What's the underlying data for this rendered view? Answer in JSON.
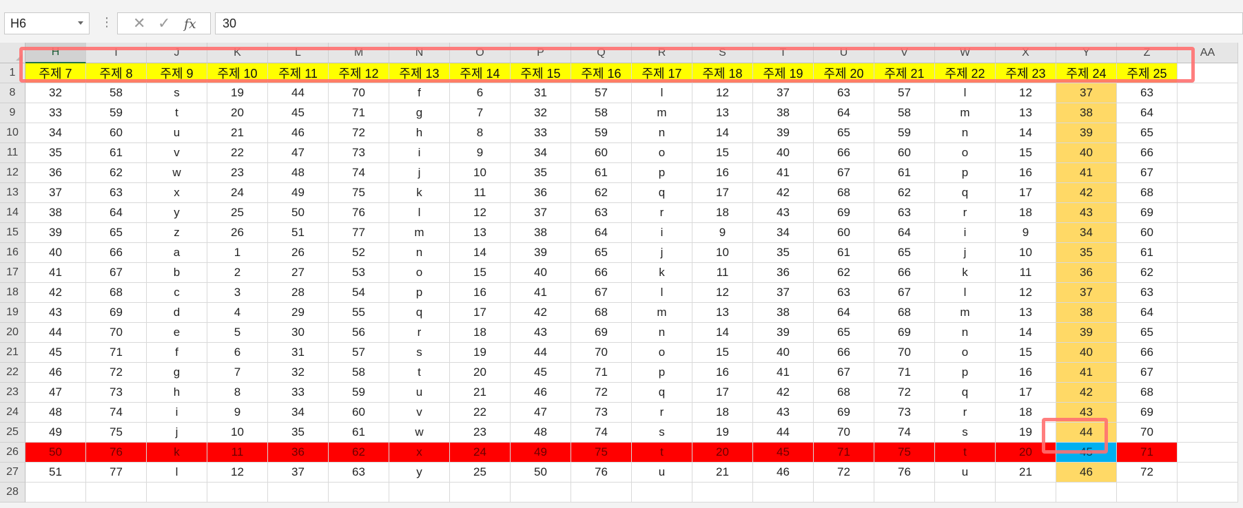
{
  "formula_bar": {
    "name_box": "H6",
    "cancel_icon": "✕",
    "enter_icon": "✓",
    "fx_label": "fx",
    "formula_value": "30"
  },
  "columns": [
    "H",
    "I",
    "J",
    "K",
    "L",
    "M",
    "N",
    "O",
    "P",
    "Q",
    "R",
    "S",
    "T",
    "U",
    "V",
    "W",
    "X",
    "Y",
    "Z",
    "AA"
  ],
  "header_row": {
    "number": "1",
    "cells": [
      "주제 7",
      "주제 8",
      "주제 9",
      "주제 10",
      "주제 11",
      "주제 12",
      "주제 13",
      "주제 14",
      "주제 15",
      "주제 16",
      "주제 17",
      "주제 18",
      "주제 19",
      "주제 20",
      "주제 21",
      "주제 22",
      "주제 23",
      "주제 24",
      "주제 25",
      ""
    ]
  },
  "rows": [
    {
      "number": "8",
      "cells": [
        "32",
        "58",
        "s",
        "19",
        "44",
        "70",
        "f",
        "6",
        "31",
        "57",
        "l",
        "12",
        "37",
        "63",
        "57",
        "l",
        "12",
        "37",
        "63",
        ""
      ]
    },
    {
      "number": "9",
      "cells": [
        "33",
        "59",
        "t",
        "20",
        "45",
        "71",
        "g",
        "7",
        "32",
        "58",
        "m",
        "13",
        "38",
        "64",
        "58",
        "m",
        "13",
        "38",
        "64",
        ""
      ]
    },
    {
      "number": "10",
      "cells": [
        "34",
        "60",
        "u",
        "21",
        "46",
        "72",
        "h",
        "8",
        "33",
        "59",
        "n",
        "14",
        "39",
        "65",
        "59",
        "n",
        "14",
        "39",
        "65",
        ""
      ]
    },
    {
      "number": "11",
      "cells": [
        "35",
        "61",
        "v",
        "22",
        "47",
        "73",
        "i",
        "9",
        "34",
        "60",
        "o",
        "15",
        "40",
        "66",
        "60",
        "o",
        "15",
        "40",
        "66",
        ""
      ]
    },
    {
      "number": "12",
      "cells": [
        "36",
        "62",
        "w",
        "23",
        "48",
        "74",
        "j",
        "10",
        "35",
        "61",
        "p",
        "16",
        "41",
        "67",
        "61",
        "p",
        "16",
        "41",
        "67",
        ""
      ]
    },
    {
      "number": "13",
      "cells": [
        "37",
        "63",
        "x",
        "24",
        "49",
        "75",
        "k",
        "11",
        "36",
        "62",
        "q",
        "17",
        "42",
        "68",
        "62",
        "q",
        "17",
        "42",
        "68",
        ""
      ]
    },
    {
      "number": "14",
      "cells": [
        "38",
        "64",
        "y",
        "25",
        "50",
        "76",
        "l",
        "12",
        "37",
        "63",
        "r",
        "18",
        "43",
        "69",
        "63",
        "r",
        "18",
        "43",
        "69",
        ""
      ]
    },
    {
      "number": "15",
      "cells": [
        "39",
        "65",
        "z",
        "26",
        "51",
        "77",
        "m",
        "13",
        "38",
        "64",
        "i",
        "9",
        "34",
        "60",
        "64",
        "i",
        "9",
        "34",
        "60",
        ""
      ]
    },
    {
      "number": "16",
      "cells": [
        "40",
        "66",
        "a",
        "1",
        "26",
        "52",
        "n",
        "14",
        "39",
        "65",
        "j",
        "10",
        "35",
        "61",
        "65",
        "j",
        "10",
        "35",
        "61",
        ""
      ]
    },
    {
      "number": "17",
      "cells": [
        "41",
        "67",
        "b",
        "2",
        "27",
        "53",
        "o",
        "15",
        "40",
        "66",
        "k",
        "11",
        "36",
        "62",
        "66",
        "k",
        "11",
        "36",
        "62",
        ""
      ]
    },
    {
      "number": "18",
      "cells": [
        "42",
        "68",
        "c",
        "3",
        "28",
        "54",
        "p",
        "16",
        "41",
        "67",
        "l",
        "12",
        "37",
        "63",
        "67",
        "l",
        "12",
        "37",
        "63",
        ""
      ]
    },
    {
      "number": "19",
      "cells": [
        "43",
        "69",
        "d",
        "4",
        "29",
        "55",
        "q",
        "17",
        "42",
        "68",
        "m",
        "13",
        "38",
        "64",
        "68",
        "m",
        "13",
        "38",
        "64",
        ""
      ]
    },
    {
      "number": "20",
      "cells": [
        "44",
        "70",
        "e",
        "5",
        "30",
        "56",
        "r",
        "18",
        "43",
        "69",
        "n",
        "14",
        "39",
        "65",
        "69",
        "n",
        "14",
        "39",
        "65",
        ""
      ]
    },
    {
      "number": "21",
      "cells": [
        "45",
        "71",
        "f",
        "6",
        "31",
        "57",
        "s",
        "19",
        "44",
        "70",
        "o",
        "15",
        "40",
        "66",
        "70",
        "o",
        "15",
        "40",
        "66",
        ""
      ]
    },
    {
      "number": "22",
      "cells": [
        "46",
        "72",
        "g",
        "7",
        "32",
        "58",
        "t",
        "20",
        "45",
        "71",
        "p",
        "16",
        "41",
        "67",
        "71",
        "p",
        "16",
        "41",
        "67",
        ""
      ]
    },
    {
      "number": "23",
      "cells": [
        "47",
        "73",
        "h",
        "8",
        "33",
        "59",
        "u",
        "21",
        "46",
        "72",
        "q",
        "17",
        "42",
        "68",
        "72",
        "q",
        "17",
        "42",
        "68",
        ""
      ]
    },
    {
      "number": "24",
      "cells": [
        "48",
        "74",
        "i",
        "9",
        "34",
        "60",
        "v",
        "22",
        "47",
        "73",
        "r",
        "18",
        "43",
        "69",
        "73",
        "r",
        "18",
        "43",
        "69",
        ""
      ]
    },
    {
      "number": "25",
      "cells": [
        "49",
        "75",
        "j",
        "10",
        "35",
        "61",
        "w",
        "23",
        "48",
        "74",
        "s",
        "19",
        "44",
        "70",
        "74",
        "s",
        "19",
        "44",
        "70",
        ""
      ]
    },
    {
      "number": "26",
      "cells": [
        "50",
        "76",
        "k",
        "11",
        "36",
        "62",
        "x",
        "24",
        "49",
        "75",
        "t",
        "20",
        "45",
        "71",
        "75",
        "t",
        "20",
        "45",
        "71",
        ""
      ]
    },
    {
      "number": "27",
      "cells": [
        "51",
        "77",
        "l",
        "12",
        "37",
        "63",
        "y",
        "25",
        "50",
        "76",
        "u",
        "21",
        "46",
        "72",
        "76",
        "u",
        "21",
        "46",
        "72",
        ""
      ]
    },
    {
      "number": "28",
      "cells": [
        "",
        "",
        "",
        "",
        "",
        "",
        "",
        "",
        "",
        "",
        "",
        "",
        "",
        "",
        "",
        "",
        "",
        "",
        "",
        ""
      ]
    }
  ],
  "highlight": {
    "header_fill": "#ffff00",
    "column_y_fill": "#ffd966",
    "row_26_fill": "#ff0000",
    "active_cell_fill": "#00b0f0",
    "callout_color": "#ff7070"
  }
}
